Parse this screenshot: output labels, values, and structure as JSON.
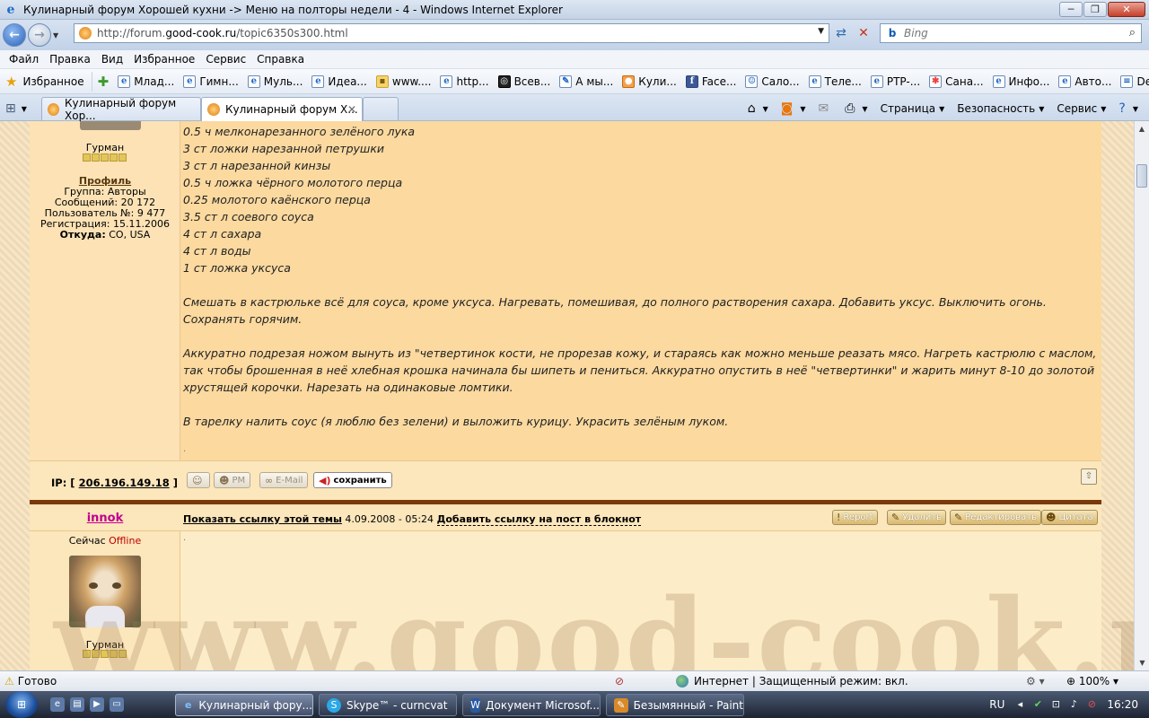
{
  "window": {
    "title": "Кулинарный форум Хорошей кухни -> Меню на полторы недели - 4 - Windows Internet Explorer"
  },
  "address": {
    "url_prefix": "http://forum.",
    "url_domain": "good-cook.ru",
    "url_suffix": "/topic6350s300.html",
    "search_placeholder": "Bing"
  },
  "menu": [
    "Файл",
    "Правка",
    "Вид",
    "Избранное",
    "Сервис",
    "Справка"
  ],
  "favorites": {
    "label": "Избранное",
    "links": [
      "Млад...",
      "Гимн...",
      "Муль...",
      "Идеа...",
      "www....",
      "http...",
      "Всев...",
      "А мы...",
      "Кули...",
      "Face...",
      "Сало...",
      "Теле...",
      "PTP-...",
      "Сана...",
      "Инфо...",
      "Авто...",
      "Depo..."
    ]
  },
  "tabs": [
    {
      "label": "Кулинарный форум Хор..."
    },
    {
      "label": "Кулинарный форум Х..."
    }
  ],
  "commands": {
    "page": "Страница",
    "safety": "Безопасность",
    "tools": "Сервис"
  },
  "post1": {
    "rank": "Гурман",
    "profile": "Профиль",
    "group": "Группа: Авторы",
    "messages": "Сообщений: 20 172",
    "user_no": "Пользователь №: 9 477",
    "registered": "Регистрация: 15.11.2006",
    "from_label": "Откуда:",
    "from_value": "CO, USA",
    "lines": [
      "0.5 ч мелконарезанного зелёного лука",
      "3 ст ложки нарезанной петрушки",
      "3 ст л нарезанной кинзы",
      "0.5 ч ложка чёрного молотого перца",
      "0.25 молотого каёнского перца",
      "3.5 ст л соевого соуса",
      "4 ст л сахара",
      "4 ст л воды",
      "1 ст ложка уксуса"
    ],
    "para1": "Смешать в кастрюльке всё для соуса, кроме уксуса. Нагревать, помешивая, до полного растворения сахара. Добавить уксус. Выключить огонь. Сохранять горячим.",
    "para2": "Аккуратно подрезая ножом вынуть из \"четвертинок кости, не прорезав кожу, и стараясь как можно меньше реазать мясо. Нагреть кастрюлю с маслом, так чтобы брошенная в неё хлебная крошка начинала бы шипеть и пениться. Аккуратно опустить в неё \"четвертинки\" и жарить минут 8-10 до золотой хрустящей корочки. Нарезать на одинаковые ломтики.",
    "para3": "В тарелку налить соус (я люблю без зелени) и выложить курицу. Украсить зелёным луком.",
    "ip_prefix": "IP: [",
    "ip": "206.196.149.18",
    "ip_suffix": "]",
    "btn_pm": "PM",
    "btn_email": "E-Mail",
    "btn_save": "сохранить"
  },
  "post2": {
    "author": "innok",
    "status_prefix": "Сейчас",
    "status": "Offline",
    "show_link": "Показать ссылку этой темы",
    "date": "4.09.2008 - 05:24",
    "add_link": "Добавить ссылку на пост в блокнот",
    "btn_report": "Report",
    "btn_delete": "Удалить",
    "btn_edit": "Редактировать",
    "btn_quote": "Цитата",
    "rank": "Гурман"
  },
  "watermark": "www.good-cook.ru",
  "statusbar": {
    "ready": "Готово",
    "zone": "Интернет | Защищенный режим: вкл.",
    "zoom": "100%"
  },
  "taskbar": {
    "items": [
      "Кулинарный фору...",
      "Skype™ - curncvat",
      "Документ Microsof...",
      "Безымянный - Paint"
    ],
    "lang": "RU",
    "time": "16:20"
  }
}
